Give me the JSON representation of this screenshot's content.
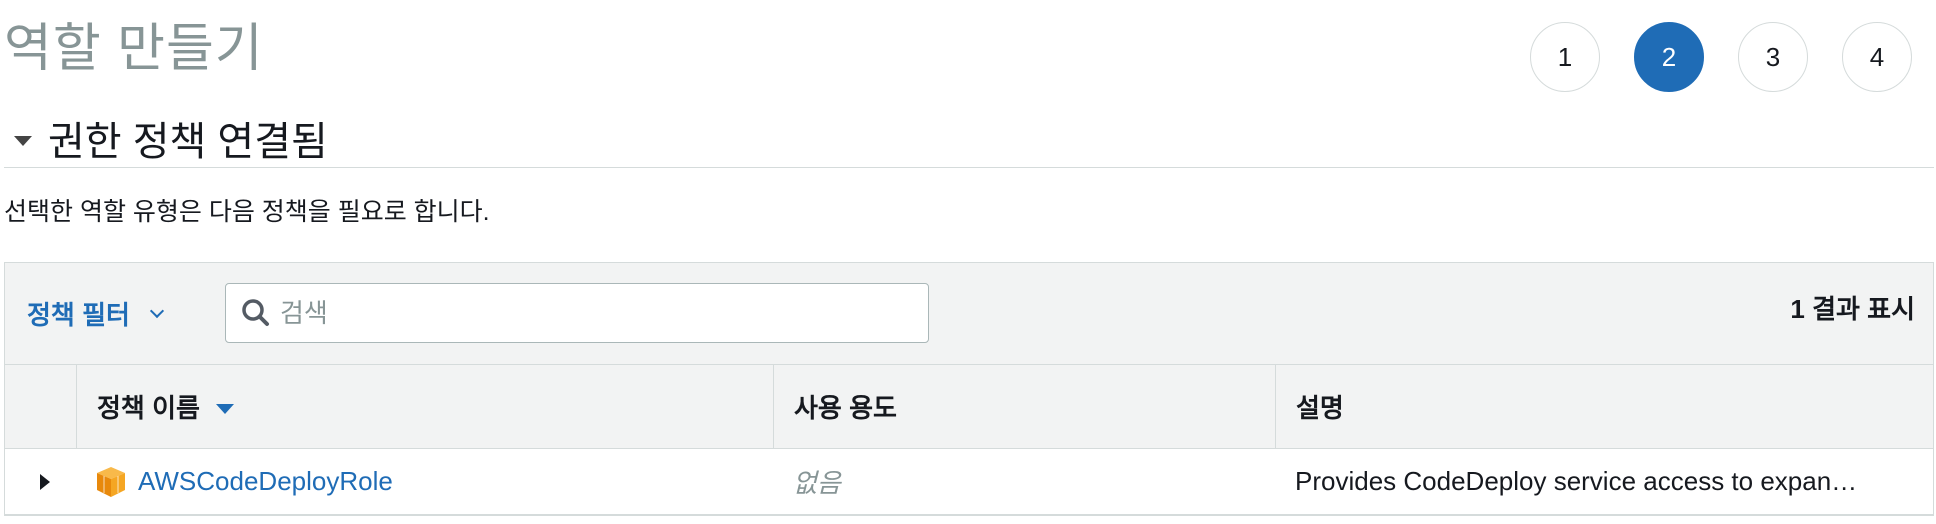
{
  "page": {
    "title": "역할 만들기"
  },
  "steps": [
    "1",
    "2",
    "3",
    "4"
  ],
  "section": {
    "title": "권한 정책 연결됨"
  },
  "description": "선택한 역할 유형은 다음 정책을 필요로 합니다.",
  "toolbar": {
    "filter_label": "정책 필터",
    "search_placeholder": "검색",
    "result_count": "1 결과 표시"
  },
  "table": {
    "columns": [
      "정책 이름",
      "사용 용도",
      "설명"
    ],
    "rows": [
      {
        "name": "AWSCodeDeployRole",
        "usage": "없음",
        "description": "Provides CodeDeploy service access to expan…"
      }
    ]
  },
  "colors": {
    "accent": "#1f6cb6",
    "muted": "#879596",
    "border": "#d5dbdb",
    "header_bg": "#f2f3f3",
    "policy_icon": "#f5a623"
  }
}
